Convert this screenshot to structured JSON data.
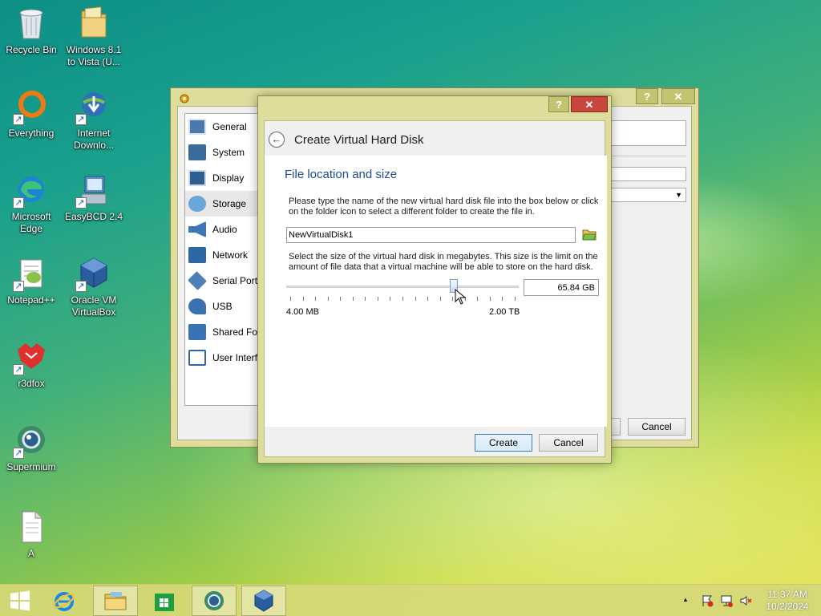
{
  "desktop": {
    "icons": [
      {
        "label": "Recycle Bin",
        "icon": "recycle-bin-icon"
      },
      {
        "label": "Windows 8.1 to Vista (U...",
        "icon": "folder-icon"
      },
      {
        "label": "Everything",
        "icon": "everything-icon"
      },
      {
        "label": "Internet Downlo...",
        "icon": "internet-download-manager-icon"
      },
      {
        "label": "Microsoft Edge",
        "icon": "edge-icon"
      },
      {
        "label": "EasyBCD 2.4",
        "icon": "easybcd-icon"
      },
      {
        "label": "Notepad++",
        "icon": "notepadpp-icon"
      },
      {
        "label": "Oracle VM VirtualBox",
        "icon": "virtualbox-icon"
      },
      {
        "label": "r3dfox",
        "icon": "r3dfox-icon"
      },
      {
        "label": "Supermium",
        "icon": "supermium-icon"
      },
      {
        "label": "A",
        "icon": "text-file-icon"
      }
    ]
  },
  "settings_window": {
    "help": "?",
    "close": "✕",
    "nav": [
      "General",
      "System",
      "Display",
      "Storage",
      "Audio",
      "Network",
      "Serial Ports",
      "USB",
      "Shared Folders",
      "User Interface"
    ],
    "cancel": "Cancel"
  },
  "dialog": {
    "help": "?",
    "close": "✕",
    "title": "Create Virtual Hard Disk",
    "section_heading": "File location and size",
    "location_text": "Please type the name of the new virtual hard disk file into the box below or click on the folder icon to select a different folder to create the file in.",
    "file_name": "NewVirtualDisk1",
    "size_text": "Select the size of the virtual hard disk in megabytes. This size is the limit on the amount of file data that a virtual machine will be able to store on the hard disk.",
    "size_value": "65.84 GB",
    "slider_min": "4.00 MB",
    "slider_max": "2.00 TB",
    "slider_position": 0.73,
    "create": "Create",
    "cancel": "Cancel"
  },
  "taskbar": {
    "items": [
      "start-icon",
      "internet-explorer-icon",
      "file-explorer-icon",
      "store-icon",
      "supermium-icon",
      "virtualbox-icon"
    ],
    "tray": {
      "chevron": "▲",
      "time": "11:37 AM",
      "date": "10/2/2024"
    }
  }
}
